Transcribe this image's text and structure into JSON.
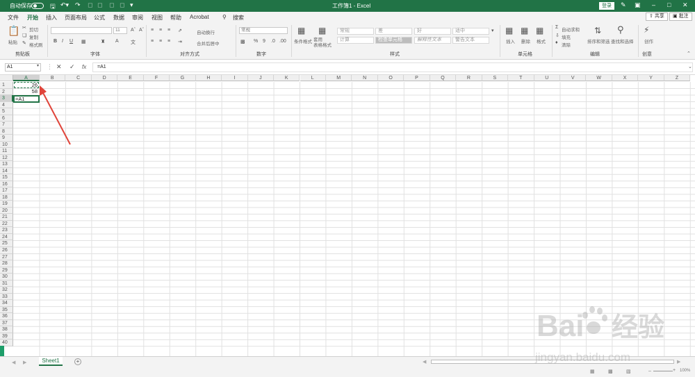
{
  "titlebar": {
    "autosave": "自动保存",
    "title": "工作簿1  -  Excel",
    "login": "登录"
  },
  "menu": {
    "tabs": [
      "文件",
      "开始",
      "插入",
      "页面布局",
      "公式",
      "数据",
      "审阅",
      "视图",
      "帮助",
      "Acrobat"
    ],
    "active_tab": "开始",
    "search": "搜索",
    "share": "共享",
    "comment": "批注"
  },
  "ribbon": {
    "clipboard": {
      "group": "剪贴板",
      "paste": "粘贴",
      "cut": "剪切",
      "copy": "复制",
      "painter": "格式刷"
    },
    "font": {
      "group": "字体",
      "size": "11"
    },
    "alignment": {
      "group": "对齐方式",
      "wrap": "自动换行",
      "merge": "合并后居中"
    },
    "number": {
      "group": "数字",
      "format": "常规"
    },
    "styles": {
      "group": "样式",
      "conditional": "条件格式",
      "as_table": "套用\n表格格式",
      "cells": [
        "常规",
        "差",
        "好",
        "适中",
        "计算",
        "检查单元格",
        "解释性文本",
        "警告文本"
      ],
      "selected": "检查单元格"
    },
    "cells": {
      "group": "单元格",
      "insert": "插入",
      "delete": "删除",
      "format": "格式"
    },
    "editing": {
      "group": "编辑",
      "autosum": "自动求和",
      "fill": "填充",
      "clear": "清除",
      "sort": "排序和筛选",
      "find": "查找和选择"
    },
    "creative": {
      "group": "创意",
      "create": "创作"
    }
  },
  "formula_bar": {
    "name_box": "A1",
    "fx": "fx",
    "formula": "=A1"
  },
  "grid": {
    "columns": [
      "A",
      "B",
      "C",
      "D",
      "E",
      "F",
      "G",
      "H",
      "I",
      "J",
      "K",
      "L",
      "M",
      "N",
      "O",
      "P",
      "Q",
      "R",
      "S",
      "T",
      "U",
      "V",
      "W",
      "X",
      "Y",
      "Z"
    ],
    "rows": 40,
    "cells": [
      {
        "ref": "A1",
        "value": "26"
      },
      {
        "ref": "A2",
        "value": "58"
      },
      {
        "ref": "A3",
        "value": "=A1"
      }
    ]
  },
  "sheets": {
    "tabs": [
      "Sheet1"
    ],
    "add": "+"
  },
  "status": {
    "zoom": "100%"
  },
  "watermark": {
    "brand": "Baidu",
    "label": "经验",
    "url": "jingyan.baidu.com"
  },
  "colors": {
    "accent": "#217346",
    "arrow": "#e0443a"
  }
}
